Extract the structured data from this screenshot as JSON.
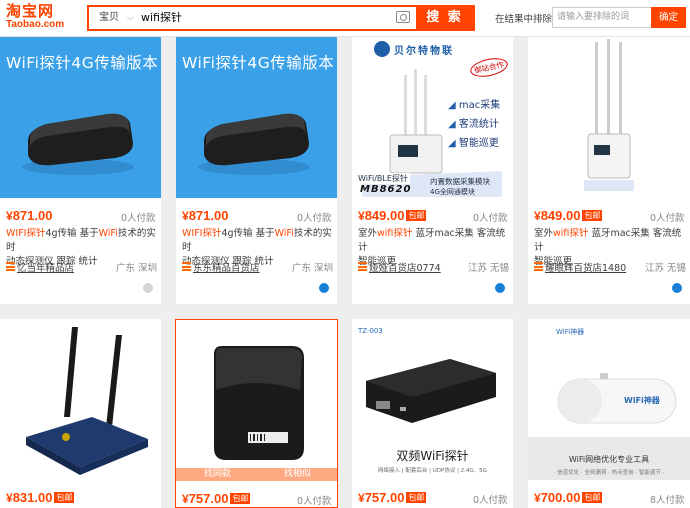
{
  "header": {
    "logo_cn": "淘宝网",
    "logo_en": "Taobao.com",
    "scope": "宝贝",
    "query": "wifi探针",
    "search_button": "搜 索",
    "exclude_label": "在结果中排除",
    "exclude_placeholder": "请输入要排除的词",
    "exclude_button": "确定"
  },
  "products": [
    {
      "banner": "WiFi探针4G传输版本",
      "price": "871.00",
      "paid": "0人付款",
      "title_hl1": "WIFI探针",
      "title_a": "4g传输 基于",
      "title_hl2": "WiFi",
      "title_b": "技术的实时",
      "line2": "动态探测仪 跟踪 统计",
      "shop": "忆当年精品店",
      "location": "广东 深圳",
      "badge": ""
    },
    {
      "banner": "WiFi探针4G传输版本",
      "price": "871.00",
      "paid": "0人付款",
      "title_hl1": "WIFI探针",
      "title_a": "4g传输 基于",
      "title_hl2": "WiFi",
      "title_b": "技术的实时",
      "line2": "动态探测仪 跟踪 统计",
      "shop": "东东精品百货店",
      "location": "广东 深圳",
      "badge": ""
    },
    {
      "price": "849.00",
      "badge": "包邮",
      "paid": "0人付款",
      "title_pre": "室外",
      "title_hl1": "wifi探针",
      "title_a": " 蓝牙mac采集 客流统计",
      "line2": "智能巡更",
      "shop": "娅娅百货店0774",
      "location": "江苏 无锡",
      "img_brand": "贝尔特物联",
      "img_stamp": "御站合作",
      "img_feat1": "mac采集",
      "img_feat2": "客流统计",
      "img_feat3": "智能巡更",
      "img_model_label": "WiFi/BLE探针",
      "img_model": "MB8620",
      "img_sub1": "内置数据采集模块",
      "img_sub2": "4G全网通模块"
    },
    {
      "price": "849.00",
      "badge": "包邮",
      "paid": "0人付款",
      "title_pre": "室外",
      "title_hl1": "wifi探针",
      "title_a": " 蓝牙mac采集 客流统计",
      "line2": "智能巡更",
      "shop": "耀眼辉百货店1480",
      "location": "江苏 无锡"
    },
    {
      "price": "831.00",
      "badge": "包邮",
      "paid": ""
    },
    {
      "price": "757.00",
      "badge": "包邮",
      "paid": "0人付款",
      "overlay_left": "找同款",
      "overlay_right": "找相似"
    },
    {
      "price": "757.00",
      "badge": "包邮",
      "paid": "0人付款",
      "img_tag": "TZ-003",
      "img_title": "双频WiFi探针",
      "img_sub": "网络接入 | 配套后台 | UDP协议 | 2.4G、5G"
    },
    {
      "price": "700.00",
      "badge": "包邮",
      "paid": "8人付款",
      "img_tag": "WiFi神器",
      "img_device": "WiFi神器",
      "img_title": "WiFi网络优化专业工具",
      "img_sub": "· 信道优化 · 全网漏洞 · 热点查询 · 智能调节 ·"
    }
  ],
  "colors": {
    "accent": "#ff4400",
    "banner_blue": "#3aa0e8",
    "wangwang": "#1a7fd6"
  }
}
